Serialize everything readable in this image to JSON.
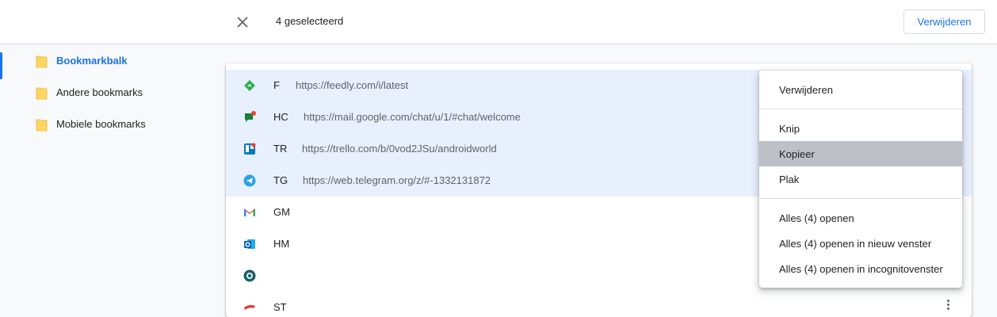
{
  "header": {
    "selection_text": "4 geselecteerd",
    "delete_label": "Verwijderen"
  },
  "sidebar": {
    "items": [
      {
        "label": "Bookmarkbalk",
        "active": true
      },
      {
        "label": "Andere bookmarks",
        "active": false
      },
      {
        "label": "Mobiele bookmarks",
        "active": false
      }
    ]
  },
  "bookmarks": [
    {
      "title": "F",
      "url": "https://feedly.com/i/latest",
      "icon": "feedly-icon",
      "selected": true
    },
    {
      "title": "HC",
      "url": "https://mail.google.com/chat/u/1/#chat/welcome",
      "icon": "google-chat-icon",
      "selected": true
    },
    {
      "title": "TR",
      "url": "https://trello.com/b/0vod2JSu/androidworld",
      "icon": "trello-icon",
      "selected": true
    },
    {
      "title": "TG",
      "url": "https://web.telegram.org/z/#-1332131872",
      "icon": "telegram-icon",
      "selected": true
    },
    {
      "title": "GM",
      "url": "",
      "icon": "gmail-icon",
      "selected": false
    },
    {
      "title": "HM",
      "url": "",
      "icon": "outlook-icon",
      "selected": false
    },
    {
      "title": "",
      "url": "",
      "icon": "app-icon",
      "selected": false
    },
    {
      "title": "ST",
      "url": "",
      "icon": "stadia-icon",
      "selected": false
    }
  ],
  "context_menu": {
    "delete": "Verwijderen",
    "cut": "Knip",
    "copy": "Kopieer",
    "paste": "Plak",
    "open_all": "Alles (4) openen",
    "open_all_new_window": "Alles (4) openen in nieuw venster",
    "open_all_incognito": "Alles (4) openen in incognitovenster"
  },
  "colors": {
    "accent": "#1a73e8",
    "selected_row": "#e8f0fe",
    "hover_menu_item": "#bdc1c6",
    "folder": "#fdd663"
  }
}
